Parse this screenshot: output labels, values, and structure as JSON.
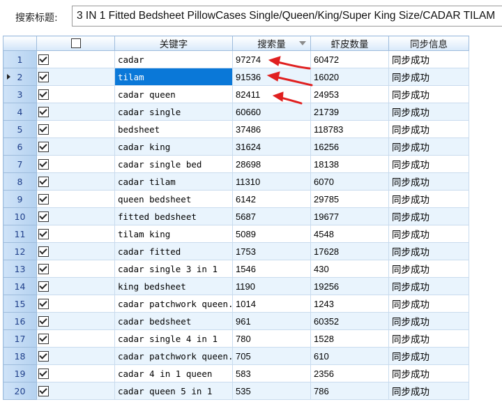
{
  "header": {
    "label": "搜索标题:",
    "title_value": "3 IN 1 Fitted Bedsheet PillowCases Single/Queen/King/Super King Size/CADAR TILAM"
  },
  "columns": {
    "keyword": "关键字",
    "search_volume": "搜索量",
    "shopee_count": "虾皮数量",
    "sync_info": "同步信息"
  },
  "rows": [
    {
      "n": "1",
      "keyword": "cadar",
      "search_volume": "97274",
      "shopee_count": "60472",
      "status": "同步成功"
    },
    {
      "n": "2",
      "keyword": "tilam",
      "search_volume": "91536",
      "shopee_count": "16020",
      "status": "同步成功"
    },
    {
      "n": "3",
      "keyword": "cadar queen",
      "search_volume": "82411",
      "shopee_count": "24953",
      "status": "同步成功"
    },
    {
      "n": "4",
      "keyword": "cadar single",
      "search_volume": "60660",
      "shopee_count": "21739",
      "status": "同步成功"
    },
    {
      "n": "5",
      "keyword": "bedsheet",
      "search_volume": "37486",
      "shopee_count": "118783",
      "status": "同步成功"
    },
    {
      "n": "6",
      "keyword": "cadar king",
      "search_volume": "31624",
      "shopee_count": "16256",
      "status": "同步成功"
    },
    {
      "n": "7",
      "keyword": "cadar single bed",
      "search_volume": "28698",
      "shopee_count": "18138",
      "status": "同步成功"
    },
    {
      "n": "8",
      "keyword": "cadar tilam",
      "search_volume": "11310",
      "shopee_count": "6070",
      "status": "同步成功"
    },
    {
      "n": "9",
      "keyword": "queen bedsheet",
      "search_volume": "6142",
      "shopee_count": "29785",
      "status": "同步成功"
    },
    {
      "n": "10",
      "keyword": "fitted bedsheet",
      "search_volume": "5687",
      "shopee_count": "19677",
      "status": "同步成功"
    },
    {
      "n": "11",
      "keyword": "tilam king",
      "search_volume": "5089",
      "shopee_count": "4548",
      "status": "同步成功"
    },
    {
      "n": "12",
      "keyword": "cadar fitted",
      "search_volume": "1753",
      "shopee_count": "17628",
      "status": "同步成功"
    },
    {
      "n": "13",
      "keyword": "cadar single 3 in 1",
      "search_volume": "1546",
      "shopee_count": "430",
      "status": "同步成功"
    },
    {
      "n": "14",
      "keyword": "king bedsheet",
      "search_volume": "1190",
      "shopee_count": "19256",
      "status": "同步成功"
    },
    {
      "n": "15",
      "keyword": "cadar patchwork queen...",
      "search_volume": "1014",
      "shopee_count": "1243",
      "status": "同步成功"
    },
    {
      "n": "16",
      "keyword": "cadar bedsheet",
      "search_volume": "961",
      "shopee_count": "60352",
      "status": "同步成功"
    },
    {
      "n": "17",
      "keyword": "cadar single 4 in 1",
      "search_volume": "780",
      "shopee_count": "1528",
      "status": "同步成功"
    },
    {
      "n": "18",
      "keyword": "cadar patchwork queen...",
      "search_volume": "705",
      "shopee_count": "610",
      "status": "同步成功"
    },
    {
      "n": "19",
      "keyword": "cadar 4 in 1 queen",
      "search_volume": "583",
      "shopee_count": "2356",
      "status": "同步成功"
    },
    {
      "n": "20",
      "keyword": "cadar queen 5 in 1",
      "search_volume": "535",
      "shopee_count": "786",
      "status": "同步成功"
    }
  ],
  "selected_row": "2",
  "colors": {
    "selection": "#0a78d8",
    "header_bg": "#d8e9fa",
    "row_alt": "#e9f4fd",
    "row_number_text": "#1f3f8a",
    "annotation_arrow": "#e02020"
  },
  "icons": {
    "sort": "sort-desc-icon",
    "checkbox": "checked-checkbox-icon",
    "row_pointer": "current-row-pointer-icon",
    "annotation": "red-arrow-icon"
  }
}
